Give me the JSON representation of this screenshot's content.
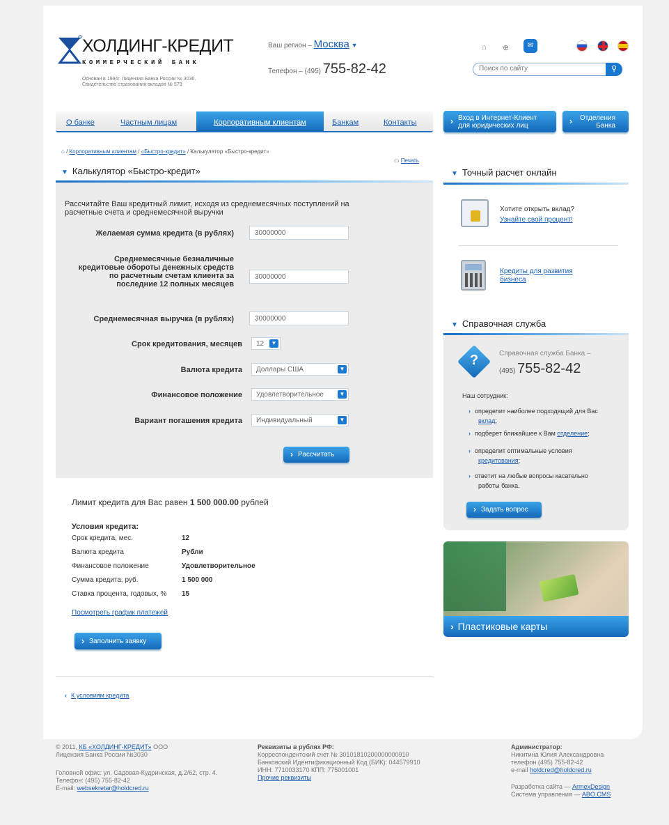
{
  "logo": {
    "name": "ХОЛДИНГ-КРЕДИТ",
    "sub": "КОММЕРЧЕСКИЙ БАНК",
    "note1": "Основан в 1994г. Лицензия Банка России № 3030.",
    "note2": "Свидетельство страхования вкладов № 579"
  },
  "header": {
    "region_label": "Ваш регион –",
    "region": "Москва",
    "phone_label": "Телефон –",
    "phone_code": "(495)",
    "phone": "755-82-42",
    "search_placeholder": "Поиск по сайту"
  },
  "nav": {
    "items": [
      "О банке",
      "Частным лицам",
      "Корпоративным клиентам",
      "Банкам",
      "Контакты"
    ],
    "btn1": "Вход в Интернет-Клиент для юридических лиц",
    "btn2": "Отделения Банка"
  },
  "breadcrumb": {
    "a": "Корпоративным клиентам",
    "b": "«Быстро-кредит»",
    "c": "Калькулятор «Быстро-кредит»"
  },
  "print": "Печать",
  "calc": {
    "title": "Калькулятор «Быстро-кредит»",
    "intro": "Рассчитайте Ваш кредитный лимит, исходя из среднемесячных поступлений на расчетные счета и среднемесячной выручки",
    "f1": "Желаемая сумма кредита (в рублях)",
    "v1": "30000000",
    "f2": "Среднемесячные безналичные кредитовые обороты денежных средств по расчетным счетам клиента за последние 12 полных месяцев",
    "v2": "30000000",
    "f3": "Среднемесячная выручка (в рублях)",
    "v3": "30000000",
    "f4": "Срок кредитования, месяцев",
    "v4": "12",
    "f5": "Валюта кредита",
    "v5": "Доллары США",
    "f6": "Финансовое положение",
    "v6": "Удовлетворительное",
    "f7": "Вариант погашения кредита",
    "v7": "Индивидуальный",
    "btn": "Рассчитать"
  },
  "result": {
    "limit_pre": "Лимит кредита для Вас равен",
    "limit": "1 500 000.00",
    "limit_post": "рублей",
    "cond_title": "Условия кредита:",
    "rows": [
      [
        "Срок кредита, мес.",
        "12"
      ],
      [
        "Валюта кредита",
        "Рубли"
      ],
      [
        "Финансовое положение",
        "Удовлетворительное"
      ],
      [
        "Сумма кредита, руб.",
        "1 500 000"
      ],
      [
        "Ставка процента, годовых, %",
        "15"
      ]
    ],
    "schedule": "Посмотреть график платежей",
    "apply": "Заполнить заявку",
    "back": "К условиям кредита"
  },
  "side": {
    "t1": "Точный расчет онлайн",
    "dep_q": "Хотите открыть вклад?",
    "dep_link": "Узнайте свой процент!",
    "loan_link": "Кредиты для развития бизнеса",
    "t2": "Справочная служба",
    "help_label": "Справочная служба Банка –",
    "help_code": "(495)",
    "help_phone": "755-82-42",
    "staff": "Наш сотрудник:",
    "b1a": "определит наиболее подходящий для Вас",
    "b1l": "вклад",
    "b2a": "подберет ближайшее к Вам",
    "b2l": "отделение",
    "b3a": "определит оптимальные условия",
    "b3l": "кредитования",
    "b4a": "ответит на любые вопросы касательно",
    "b4b": "работы банка.",
    "ask": "Задать вопрос",
    "cards": "Пластиковые карты"
  },
  "footer": {
    "copy": "© 2011,",
    "org": "КБ «ХОЛДИНГ-КРЕДИТ»",
    "ooo": "ООО",
    "lic": "Лицензия Банка России №3030",
    "addr": "Головной офис: ул. Садовая-Кудринская, д.2/62, стр. 4.",
    "tel": "Телефон: (495) 755-82-42",
    "email_label": "E-mail:",
    "email": "websekretar@holdcred.ru",
    "req_title": "Реквизиты в рублях РФ:",
    "req1": "Корреспондентский счет № 30101810200000000910",
    "req2": "Банковский Идентификационный Код (БИК): 044579910",
    "req3": "ИНН: 7710033170 КПП: 775001001",
    "req_link": "Прочие реквизиты",
    "adm_title": "Администратор:",
    "adm1": "Никитина Юлия Александровна",
    "adm2": "телефон (495) 755-82-42",
    "adm_email_label": "e-mail",
    "adm_email": "holdcred@holdcred.ru",
    "dev_label": "Разработка сайта —",
    "dev": "ArmexDesign",
    "cms_label": "Система управления —",
    "cms": "ABO.CMS"
  }
}
